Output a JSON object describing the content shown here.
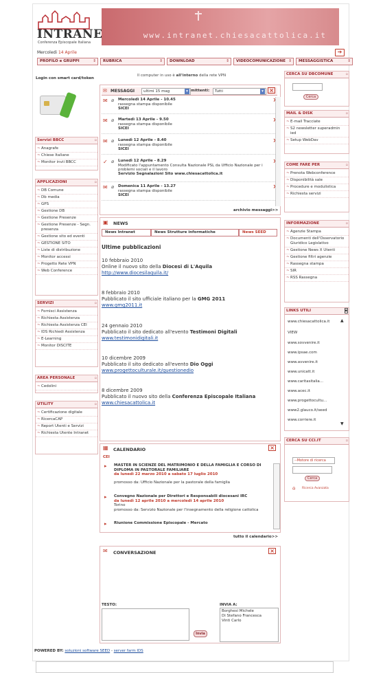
{
  "header": {
    "logo_word": "INTRANET",
    "logo_sub": "Conferenza Episcopale Italiana",
    "banner_url": "www.intranet.chiesacattolica.it",
    "date_label": "Mercoledi",
    "date_value": "14 Aprile"
  },
  "nav": [
    {
      "label": "PROFILO e GRUPPI"
    },
    {
      "label": "RUBRICA"
    },
    {
      "label": "DOWNLOAD"
    },
    {
      "label": "VIDEOCOMUNICAZIONE"
    },
    {
      "label": "MESSAGGISTICA"
    }
  ],
  "left": {
    "login_title": "Login con smart card/token",
    "servizi_bbcc": {
      "title": "Servizi BBCC",
      "items": [
        "Anagrafe",
        "Chiese Italiane",
        "Monitor invii BBCC"
      ]
    },
    "applicazioni": {
      "title": "APPLICAZIONI",
      "items": [
        "DB Comune",
        "Db media",
        "GPS",
        "Gestione DB",
        "Gestione Presenze",
        "Gestione Presenze - Segn. presenza",
        "Gestione sito ed eventi",
        "GESTIONE SITO",
        "Liste di distribuzione",
        "Monitor accessi",
        "Progetto Rete VPN",
        "Web Conference"
      ]
    },
    "servizi": {
      "title": "SERVIZI",
      "items": [
        "Fornisci Assistenza",
        "Richiesta Assistenza",
        "Richiesta Assistenza CEI",
        "IDS Richiedi Assistenza",
        "E-Learning",
        "Monitor DISCITE"
      ]
    },
    "area_personale": {
      "title": "AREA PERSONALE",
      "items": [
        "Cedolini"
      ]
    },
    "utility": {
      "title": "UTILITY",
      "items": [
        "Certificazione digitale",
        "RicercaCAP",
        "Report Utenti e Servizi",
        "Richiesta Utente Intranet"
      ]
    }
  },
  "center": {
    "vpn_notice_pre": "Il computer in uso è ",
    "vpn_notice_bold": "all'interno",
    "vpn_notice_post": " della rete VPN",
    "messages": {
      "title": "MESSAGGI",
      "period": "ultimi 15 mag",
      "sender_label": "mittenti:",
      "sender_value": "Tutti",
      "items": [
        {
          "title": "Mercoledì 14 Aprile - 10.45",
          "line1": "rassegna stampa disponibile",
          "line2": "SICEI"
        },
        {
          "title": "Martedì 13 Aprile - 9.50",
          "line1": "rassegna stampa disponibile",
          "line2": "SICEI"
        },
        {
          "title": "Lunedì 12 Aprile - 8.40",
          "line1": "rassegna stampa disponibile",
          "line2": "SICEI"
        },
        {
          "title": "Lunedì 12 Aprile - 8.29",
          "line1": "Modificato l'appuntamento Consulta Nazionale PSL da Ufficio Nazionale per i problemi sociali e il lavoro",
          "line2": "Servizio Segnalazioni Sito www.chiesacattolica.it"
        },
        {
          "title": "Domenica 11 Aprile - 13.27",
          "line1": "rassegna stampa disponibile",
          "line2": "SICEI"
        }
      ],
      "archive": "archivio messaggi>>"
    },
    "news": {
      "title": "NEWS",
      "tabs": [
        "News Intranet",
        "News Strutture informatiche",
        "News SEED"
      ],
      "heading": "Ultime pubblicazioni",
      "items": [
        {
          "date": "10 febbraio 2010",
          "text": "Online il nuovo sito della ",
          "bold": "Diocesi di L'Aquila",
          "link": "http://www.diocesilaquila.it/"
        },
        {
          "date": "8 febbraio 2010",
          "text": "Pubblicato il sito ufficiale italiano per la ",
          "bold": "GMG 2011",
          "link": "www.gmg2011.it"
        },
        {
          "date": "24 gennaio 2010",
          "text": "Pubblicato il sito dedicato all'evento ",
          "bold": "Testimoni Digitali",
          "link": "www.testimonidigitali.it"
        },
        {
          "date": "10 dicembre 2009",
          "text": "Pubblicato il sito dedicato all'evento ",
          "bold": "Dio Oggi",
          "link": "www.progettoculturale.it/questionedio"
        },
        {
          "date": "8 dicembre 2009",
          "text": "Pubblicato il nuovo sito della ",
          "bold": "Conferenza Episcopale Italiana",
          "link": "www.chiesacattolica.it"
        }
      ]
    },
    "calendar": {
      "title": "CALENDARIO",
      "tag": "CEI",
      "events": [
        {
          "title": "MASTER IN SCIENZE DEL MATRIMONIO E DELLA FAMIGLIA E CORSO DI DIPLOMA IN PASTORALE FAMILIARE",
          "dates": "da lunedì 22 marzo 2010 a sabato 17 luglio 2010",
          "promo": "promosso da: Ufficio Nazionale per la pastorale della famiglia"
        },
        {
          "title": "Convegno Nazionale per Direttori e Responsabili diocesani IRC",
          "dates": "da lunedì 12 aprile 2010 a mercoledì 14 aprile 2010",
          "place": "Torino",
          "promo": "promosso da: Servizio Nazionale per l'insegnamento della religione cattolica"
        },
        {
          "title": "Riunione Commissione Episcopale - Mercato"
        }
      ],
      "all": "tutto il calendario>>"
    },
    "chat": {
      "title": "CONVERSAZIONE",
      "text_label": "TESTO:",
      "invia_label": "INVIA A:",
      "recipients": [
        "Borghesi Michele",
        "Di Stefano Francesca",
        "Vinti Carlo"
      ],
      "send": "Invia"
    }
  },
  "right": {
    "cerca_dbcomune": {
      "title": "CERCA SU DBCOMUNE",
      "btn": "Cerca"
    },
    "mail": {
      "title": "MAIL & DISK",
      "items": [
        "E-mail Tracciate",
        "S2 newsletter superadmin ied",
        "Setup WebDav"
      ]
    },
    "come_fare": {
      "title": "COME FARE PER",
      "items": [
        "Prenota Webconference",
        "Disponibilità sale",
        "Procedure e modulistica",
        "Richiesta servizi"
      ]
    },
    "informazione": {
      "title": "INFORMAZIONE",
      "items": [
        "Agenzie Stampa",
        "Documenti dell'Osservatorio Giuridico Legislativo",
        "Gestione News X Utenti",
        "Gestione filtri agenzie",
        "Rassegna stampa",
        "SIR",
        "RSS Rassegna"
      ]
    },
    "links": {
      "title": "LINKS UTILI",
      "items": [
        "www.chiesacattolica.it",
        "VIEW",
        "www.sovvenire.it",
        "www.ipsae.com",
        "www.avvenire.it",
        "www.unicatt.it",
        "www.caritasitalia...",
        "www.acec.it",
        "www.progettocultu...",
        "www2.glauco.it/seed",
        "www.corriere.it"
      ]
    },
    "cerca_cci": {
      "title": "CERCA SU CCI.IT",
      "select": "--Motore di ricerca",
      "btn": "Cerca",
      "advanced": "Ricerca Avanzata"
    }
  },
  "footer": {
    "powered": "POWERED BY:",
    "link1": "soluzioni software SEED",
    "sep": " - ",
    "link2": "server farm IDS"
  }
}
